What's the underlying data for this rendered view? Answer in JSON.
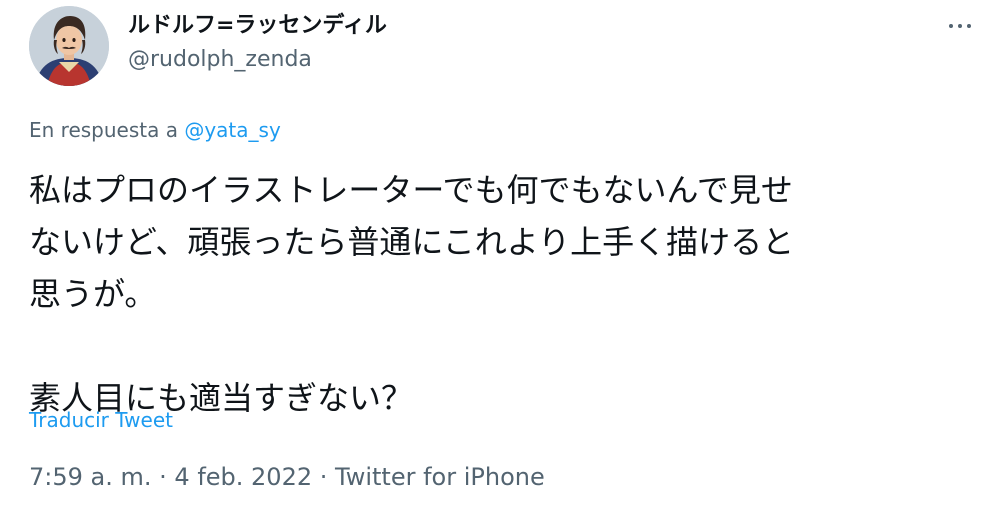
{
  "author": {
    "display_name": "ルドルフ=ラッセンディル",
    "handle": "@rudolph_zenda",
    "avatar_icon": "user-avatar-icon"
  },
  "more_options_icon": "more-horizontal-icon",
  "reply": {
    "prefix": "En respuesta a",
    "mention": "@yata_sy"
  },
  "tweet": {
    "lines": [
      "私はプロのイラストレーターでも何でもないんで見せ",
      "ないけど、頑張ったら普通にこれより上手く描けると",
      "思うが。",
      "",
      "素人目にも適当すぎない？"
    ]
  },
  "translate_label": "Traducir Tweet",
  "meta": {
    "time": "7:59 a. m.",
    "separator": "·",
    "date": "4 feb. 2022",
    "source": "Twitter for iPhone"
  },
  "colors": {
    "text": "#0f1419",
    "secondary": "#536471",
    "link": "#1d9bf0"
  }
}
